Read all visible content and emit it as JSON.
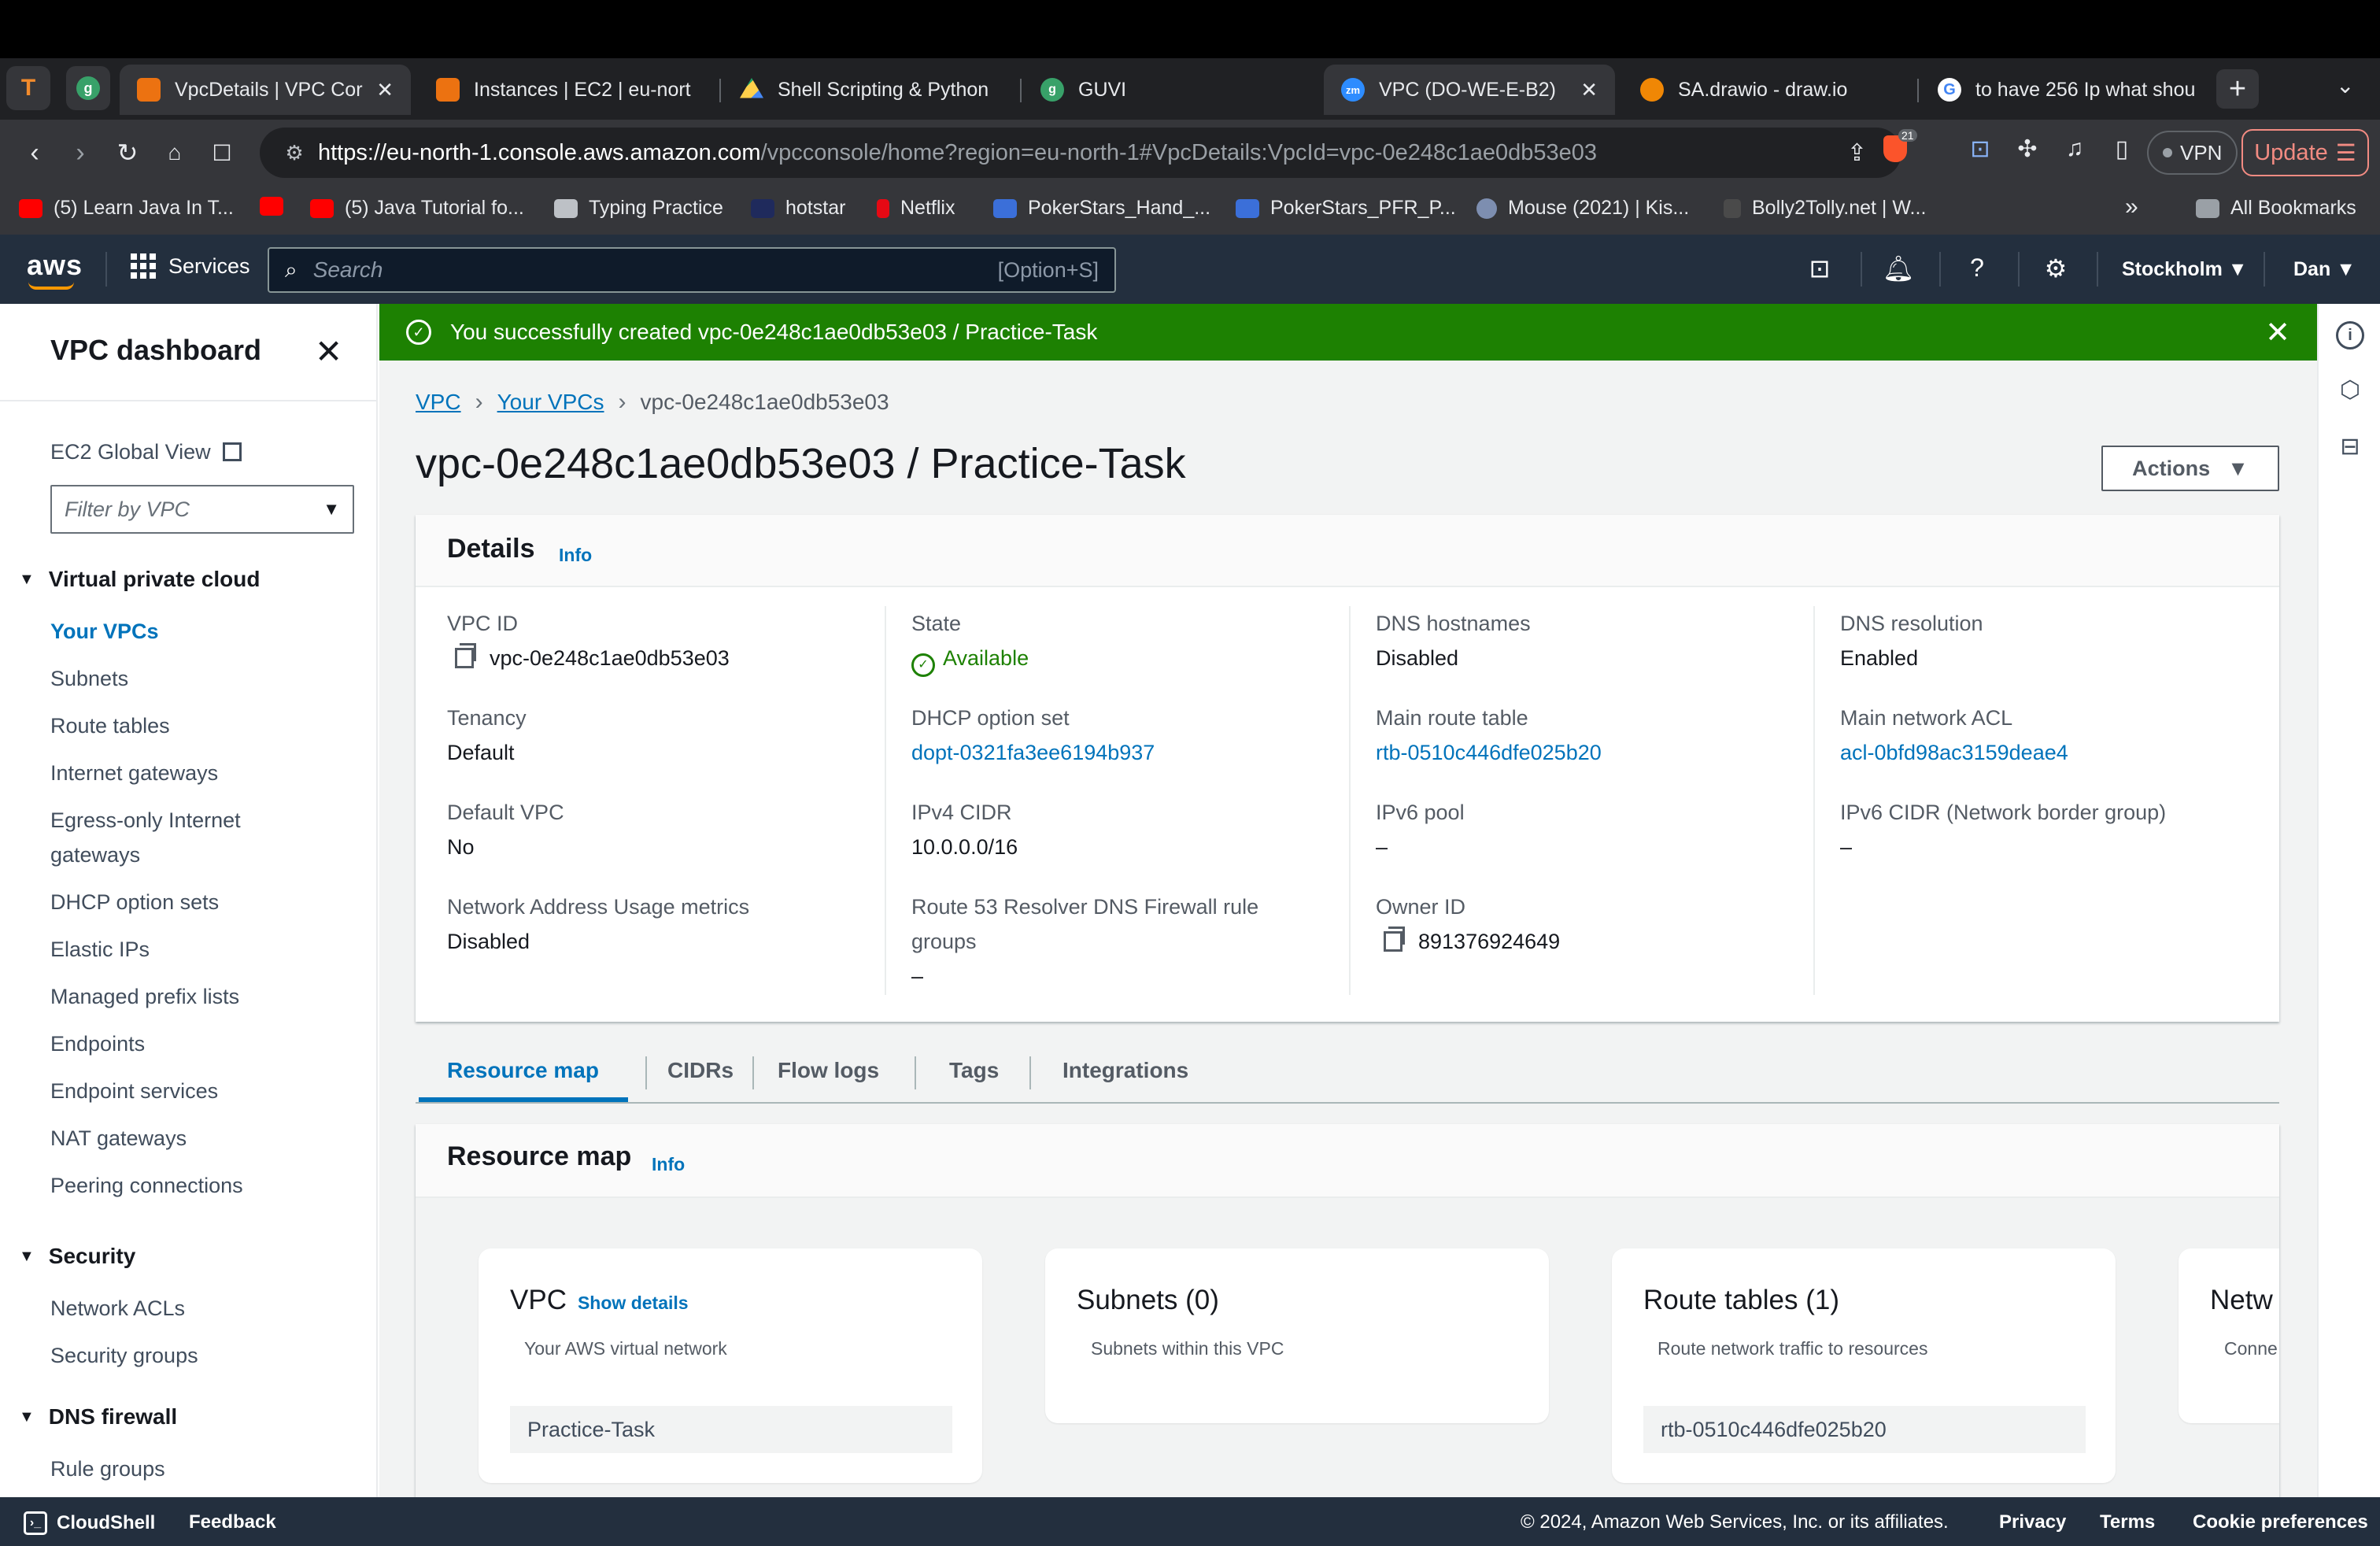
{
  "browser": {
    "pinned": [
      {
        "letter": "T",
        "color": "#f28b2c"
      },
      {
        "letter": "g",
        "color": "#38a169"
      }
    ],
    "tabs": [
      {
        "title": "VpcDetails | VPC Cor",
        "icon": "aws-cube-icon",
        "color": "#ec7211",
        "close": "✕"
      },
      {
        "title": "Instances | EC2 | eu-nort",
        "icon": "aws-ec2-icon",
        "color": "#ec7211"
      },
      {
        "title": "Shell Scripting & Python",
        "icon": "google-drive-icon",
        "color": "#1fa463"
      },
      {
        "title": "GUVI",
        "icon": "guvi-icon",
        "color": "#38a169"
      },
      {
        "title": "VPC (DO-WE-E-B2)",
        "icon": "zoom-icon",
        "color": "#2d8cff",
        "close": "✕"
      },
      {
        "title": "SA.drawio - draw.io",
        "icon": "drawio-icon",
        "color": "#f08705"
      },
      {
        "title": "to have 256 Ip what shou",
        "icon": "google-icon",
        "color": "#ffffff"
      }
    ],
    "url_host": "https://eu-north-1.console.aws.amazon.com",
    "url_rest": "/vpcconsole/home?region=eu-north-1#VpcDetails:VpcId=vpc-0e248c1ae0db53e03",
    "brave_badge": "21",
    "vpn_label": "VPN",
    "update_label": "Update",
    "bookmarks": [
      {
        "label": "(5) Learn Java In T...",
        "color": "#ff0000"
      },
      {
        "label": "(5) Java Tutorial fo...",
        "color": "#ff0000"
      },
      {
        "label": "Typing Practice",
        "color": "#9aa0a6"
      },
      {
        "label": "hotstar",
        "color": "#1f2a5c"
      },
      {
        "label": "Netflix",
        "color": "#e50914"
      },
      {
        "label": "PokerStars_Hand_...",
        "color": "#3b6fd9"
      },
      {
        "label": "PokerStars_PFR_P...",
        "color": "#3b6fd9"
      },
      {
        "label": "Mouse (2021) | Kis...",
        "color": "#7d8eb0"
      },
      {
        "label": "Bolly2Tolly.net | W...",
        "color": "#4a4a4a"
      }
    ],
    "bookmarks_overflow": "»",
    "all_bookmarks": "All Bookmarks"
  },
  "aws_nav": {
    "logo": "aws",
    "services": "Services",
    "search_placeholder": "Search",
    "search_shortcut": "[Option+S]",
    "region": "Stockholm",
    "user": "Dan"
  },
  "sidebar": {
    "title": "VPC dashboard",
    "ec2_global_view": "EC2 Global View",
    "filter_placeholder": "Filter by VPC",
    "sections": [
      {
        "title": "Virtual private cloud",
        "items": [
          "Your VPCs",
          "Subnets",
          "Route tables",
          "Internet gateways",
          "Egress-only Internet",
          "gateways",
          "DHCP option sets",
          "Elastic IPs",
          "Managed prefix lists",
          "Endpoints",
          "Endpoint services",
          "NAT gateways",
          "Peering connections"
        ]
      },
      {
        "title": "Security",
        "items": [
          "Network ACLs",
          "Security groups"
        ]
      },
      {
        "title": "DNS firewall",
        "items": [
          "Rule groups"
        ]
      }
    ]
  },
  "flash": {
    "message": "You successfully created vpc-0e248c1ae0db53e03 / Practice-Task",
    "color": "#1d8102"
  },
  "breadcrumb": [
    "VPC",
    "Your VPCs",
    "vpc-0e248c1ae0db53e03"
  ],
  "page_title": "vpc-0e248c1ae0db53e03 / Practice-Task",
  "actions_label": "Actions",
  "details": {
    "title": "Details",
    "info": "Info",
    "columns": [
      [
        {
          "key": "VPC ID",
          "value": "vpc-0e248c1ae0db53e03"
        },
        {
          "key": "Tenancy",
          "value": "Default"
        },
        {
          "key": "Default VPC",
          "value": "No"
        },
        {
          "key": "Network Address Usage metrics",
          "value": "Disabled"
        }
      ],
      [
        {
          "key": "State",
          "value": "Available"
        },
        {
          "key": "DHCP option set",
          "value": "dopt-0321fa3ee6194b937"
        },
        {
          "key": "IPv4 CIDR",
          "value": "10.0.0.0/16"
        },
        {
          "key": "Route 53 Resolver DNS Firewall rule",
          "key2": "groups",
          "value": "–"
        }
      ],
      [
        {
          "key": "DNS hostnames",
          "value": "Disabled"
        },
        {
          "key": "Main route table",
          "value": "rtb-0510c446dfe025b20"
        },
        {
          "key": "IPv6 pool",
          "value": "–"
        },
        {
          "key": "Owner ID",
          "value": "891376924649"
        }
      ],
      [
        {
          "key": "DNS resolution",
          "value": "Enabled"
        },
        {
          "key": "Main network ACL",
          "value": "acl-0bfd98ac3159deae4"
        },
        {
          "key": "IPv6 CIDR (Network border group)",
          "value": "–"
        }
      ]
    ]
  },
  "tabs": [
    "Resource map",
    "CIDRs",
    "Flow logs",
    "Tags",
    "Integrations"
  ],
  "resource_map": {
    "title": "Resource map",
    "info": "Info",
    "cards": [
      {
        "title": "VPC",
        "link": "Show details",
        "subtitle": "Your AWS virtual network",
        "pill": "Practice-Task"
      },
      {
        "title": "Subnets (0)",
        "subtitle": "Subnets within this VPC"
      },
      {
        "title": "Route tables (1)",
        "subtitle": "Route network traffic to resources",
        "pill": "rtb-0510c446dfe025b20"
      },
      {
        "title": "Netw",
        "subtitle": "Conne"
      }
    ]
  },
  "footer": {
    "cloudshell": "CloudShell",
    "feedback": "Feedback",
    "copyright": "© 2024, Amazon Web Services, Inc. or its affiliates.",
    "privacy": "Privacy",
    "terms": "Terms",
    "cookies": "Cookie preferences"
  }
}
